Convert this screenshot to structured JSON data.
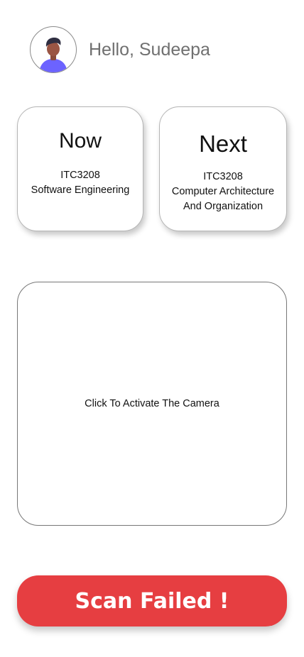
{
  "header": {
    "greeting": "Hello, Sudeepa",
    "avatar_icon": "user-avatar-icon"
  },
  "cards": {
    "now": {
      "title": "Now",
      "code": "ITC3208",
      "name": "Software Engineering"
    },
    "next": {
      "title": "Next",
      "code": "ITC3208",
      "name_line1": "Computer Architecture",
      "name_line2": "And Organization"
    }
  },
  "camera": {
    "prompt": "Click To Activate The Camera"
  },
  "scan": {
    "status_label": "Scan Failed !",
    "color": "#e63e41"
  }
}
